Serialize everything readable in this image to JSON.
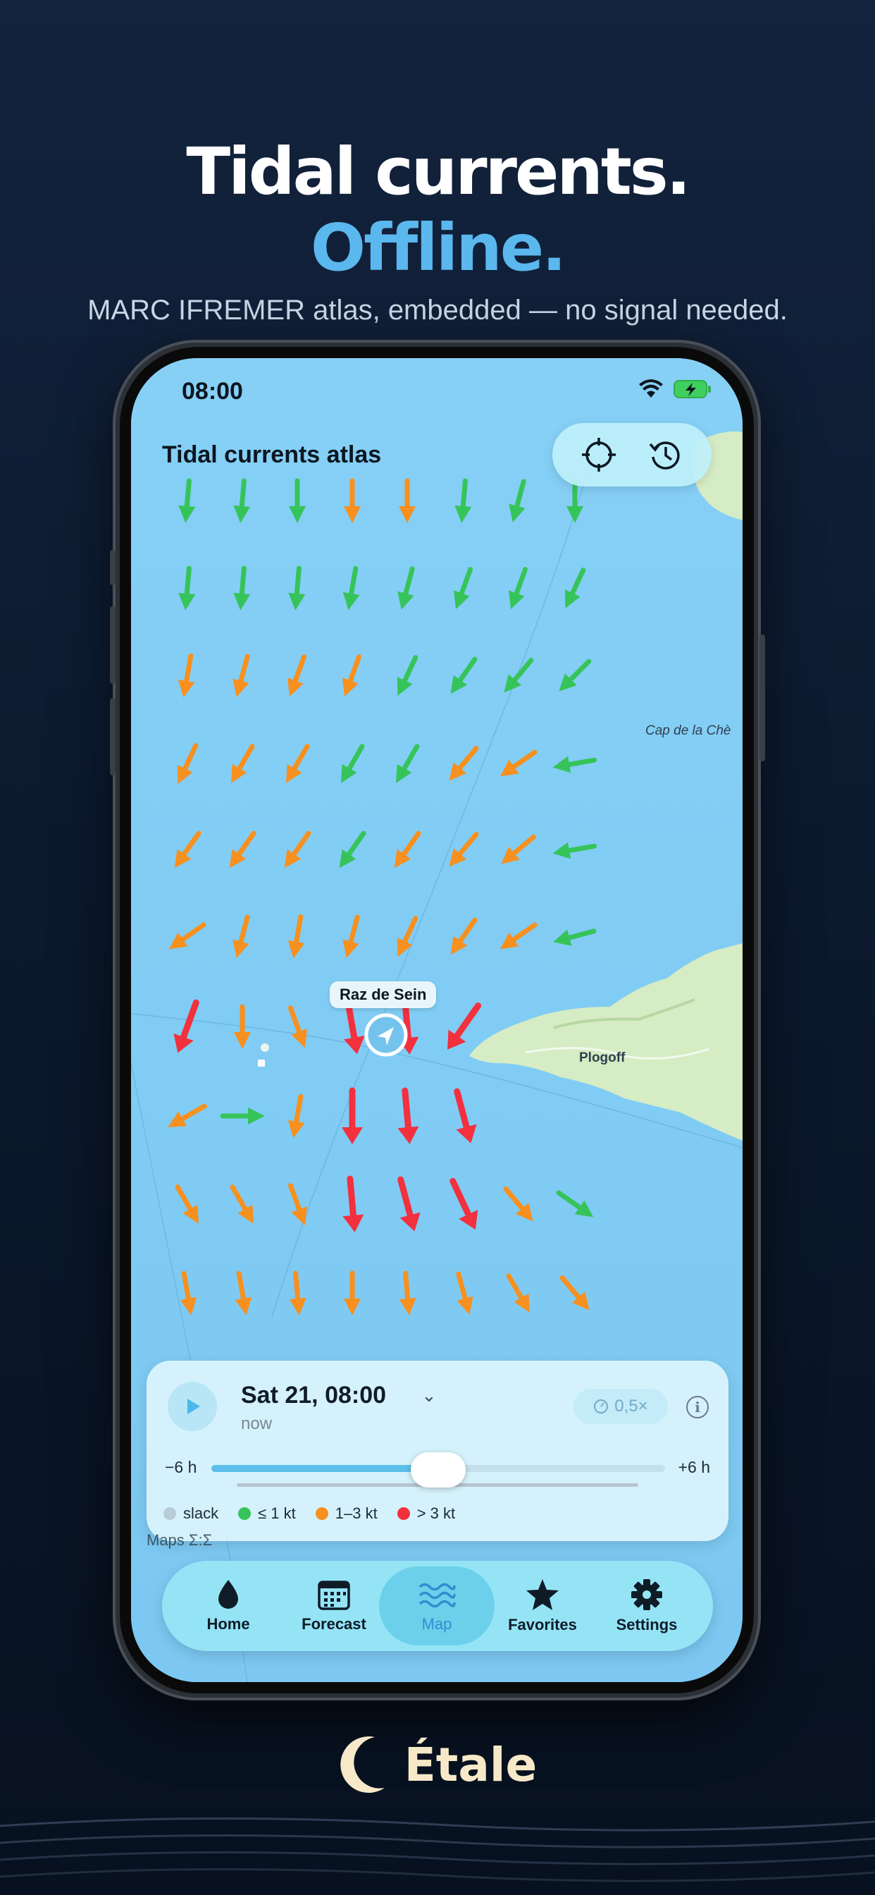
{
  "promo": {
    "headline_line1": "Tidal currents.",
    "headline_line2": "Offline.",
    "subtitle": "MARC IFREMER atlas, embedded — no signal needed.",
    "brand_name": "Étale"
  },
  "status_bar": {
    "time": "08:00"
  },
  "map": {
    "title": "Tidal currents atlas",
    "pin_label": "Raz de Sein",
    "place_labels": [
      "Cap de la Chè",
      "Plogoff"
    ],
    "credit": "Maps Σ:Σ"
  },
  "time_panel": {
    "date": "Sat 21, 08:00",
    "relative": "now",
    "speed": "0,5×",
    "slider_min": "−6 h",
    "slider_max": "+6 h",
    "slider_position": 0.5
  },
  "legend": [
    {
      "label": "slack",
      "color": "#b9cdd8"
    },
    {
      "label": "≤ 1 kt",
      "color": "#36c45a"
    },
    {
      "label": "1–3 kt",
      "color": "#f7901e"
    },
    {
      "label": "> 3 kt",
      "color": "#f2303e"
    }
  ],
  "tabs": [
    {
      "label": "Home",
      "icon": "drop-icon",
      "active": false
    },
    {
      "label": "Forecast",
      "icon": "calendar-icon",
      "active": false
    },
    {
      "label": "Map",
      "icon": "waves-icon",
      "active": true
    },
    {
      "label": "Favorites",
      "icon": "star-icon",
      "active": false
    },
    {
      "label": "Settings",
      "icon": "gear-icon",
      "active": false
    }
  ],
  "colors": {
    "accent": "#5ab8ee",
    "sea": "#7dcaf4",
    "land": "#d6ecc4"
  }
}
